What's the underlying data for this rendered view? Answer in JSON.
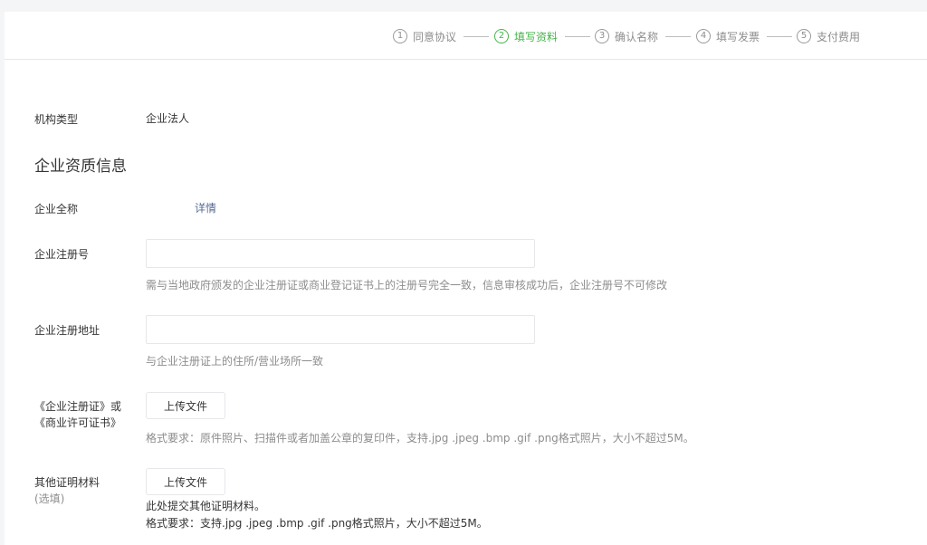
{
  "steps": [
    {
      "num": "1",
      "label": "同意协议",
      "active": false
    },
    {
      "num": "2",
      "label": "填写资料",
      "active": true
    },
    {
      "num": "3",
      "label": "确认名称",
      "active": false
    },
    {
      "num": "4",
      "label": "填写发票",
      "active": false
    },
    {
      "num": "5",
      "label": "支付费用",
      "active": false
    }
  ],
  "colors": {
    "accent": "#44b549",
    "link": "#576b95",
    "hint": "#8d8d8d"
  },
  "org_type": {
    "label": "机构类型",
    "value": "企业法人"
  },
  "section_title": "企业资质信息",
  "full_name": {
    "label": "企业全称",
    "value": "",
    "detail_link": "详情"
  },
  "reg_number": {
    "label": "企业注册号",
    "value": "",
    "hint": "需与当地政府颁发的企业注册证或商业登记证书上的注册号完全一致，信息审核成功后，企业注册号不可修改"
  },
  "reg_address": {
    "label": "企业注册地址",
    "value": "",
    "hint": "与企业注册证上的住所/营业场所一致"
  },
  "license": {
    "label_line1": "《企业注册证》或",
    "label_line2": "《商业许可证书》",
    "button": "上传文件",
    "hint": "格式要求：原件照片、扫描件或者加盖公章的复印件，支持.jpg .jpeg .bmp .gif .png格式照片，大小不超过5M。"
  },
  "other": {
    "label": "其他证明材料",
    "sublabel": "(选填)",
    "button": "上传文件",
    "hint_line1": "此处提交其他证明材料。",
    "hint_line2": "格式要求：支持.jpg .jpeg .bmp .gif .png格式照片，大小不超过5M。"
  }
}
